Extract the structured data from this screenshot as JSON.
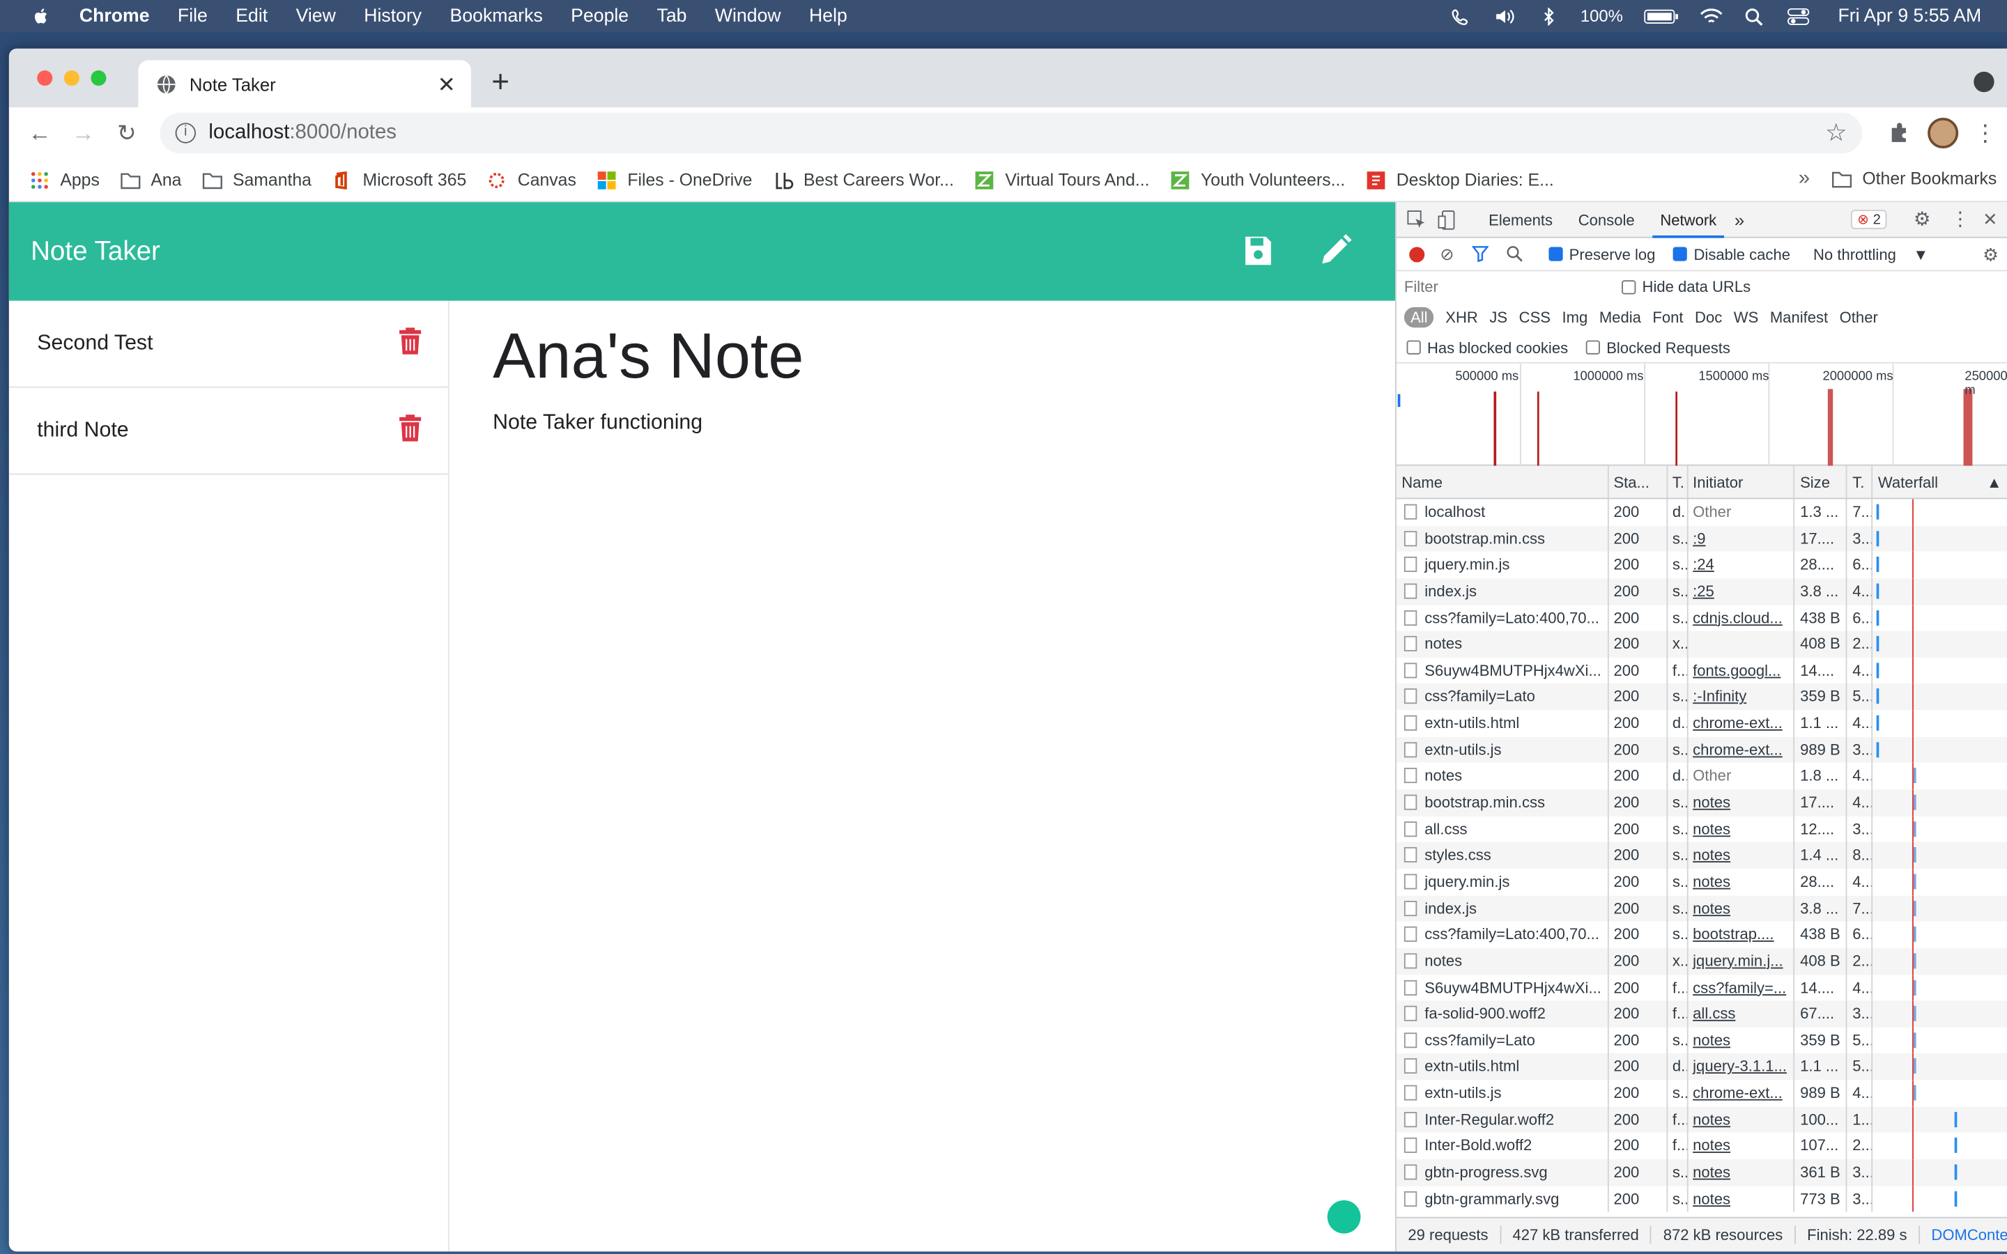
{
  "menubar": {
    "items": [
      "Chrome",
      "File",
      "Edit",
      "View",
      "History",
      "Bookmarks",
      "People",
      "Tab",
      "Window",
      "Help"
    ],
    "battery": "100%",
    "clock": "Fri Apr 9  5:55 AM"
  },
  "browser": {
    "tab_title": "Note Taker",
    "url_host": "localhost",
    "url_path": ":8000/notes",
    "bookmarks": [
      "Apps",
      "Ana",
      "Samantha",
      "Microsoft 365",
      "Canvas",
      "Files - OneDrive",
      "Best Careers Wor...",
      "Virtual Tours And...",
      "Youth Volunteers...",
      "Desktop Diaries: E..."
    ],
    "bookmarks_more": "»",
    "other_bookmarks": "Other Bookmarks"
  },
  "app": {
    "brand": "Note Taker",
    "notes": [
      "Second Test",
      "third Note"
    ],
    "active_title": "Ana's Note",
    "active_body": "Note Taker functioning"
  },
  "devtools": {
    "tabs": [
      "Elements",
      "Console",
      "Network"
    ],
    "more": "»",
    "error_count": "2",
    "preserve_log": "Preserve log",
    "disable_cache": "Disable cache",
    "throttling": "No throttling",
    "filter_placeholder": "Filter",
    "hide_data_urls": "Hide data URLs",
    "filter_types": [
      "All",
      "XHR",
      "JS",
      "CSS",
      "Img",
      "Media",
      "Font",
      "Doc",
      "WS",
      "Manifest",
      "Other"
    ],
    "has_blocked_cookies": "Has blocked cookies",
    "blocked_requests": "Blocked Requests",
    "timeline_ticks": [
      "500000 ms",
      "1000000 ms",
      "1500000 ms",
      "2000000 ms",
      "2500000 m"
    ],
    "columns": [
      "Name",
      "Sta...",
      "T.",
      "Initiator",
      "Size",
      "T.",
      "Waterfall"
    ],
    "rows": [
      [
        "localhost",
        "200",
        "d.",
        "Other",
        "1.3 ...",
        "7..."
      ],
      [
        "bootstrap.min.css",
        "200",
        "s..",
        ":9",
        "17....",
        "3..."
      ],
      [
        "jquery.min.js",
        "200",
        "s..",
        ":24",
        "28....",
        "6..."
      ],
      [
        "index.js",
        "200",
        "s..",
        ":25",
        "3.8 ...",
        "4..."
      ],
      [
        "css?family=Lato:400,70...",
        "200",
        "s..",
        "cdnjs.cloud...",
        "438 B",
        "6..."
      ],
      [
        "notes",
        "200",
        "x..",
        "",
        "408 B",
        "2..."
      ],
      [
        "S6uyw4BMUTPHjx4wXi...",
        "200",
        "f...",
        "fonts.googl...",
        "14....",
        "4..."
      ],
      [
        "css?family=Lato",
        "200",
        "s..",
        ":-Infinity",
        "359 B",
        "5..."
      ],
      [
        "extn-utils.html",
        "200",
        "d..",
        "chrome-ext...",
        "1.1 ...",
        "4..."
      ],
      [
        "extn-utils.js",
        "200",
        "s..",
        "chrome-ext...",
        "989 B",
        "3..."
      ],
      [
        "notes",
        "200",
        "d..",
        "Other",
        "1.8 ...",
        "4..."
      ],
      [
        "bootstrap.min.css",
        "200",
        "s..",
        "notes",
        "17....",
        "4..."
      ],
      [
        "all.css",
        "200",
        "s..",
        "notes",
        "12....",
        "3..."
      ],
      [
        "styles.css",
        "200",
        "s..",
        "notes",
        "1.4 ...",
        "8..."
      ],
      [
        "jquery.min.js",
        "200",
        "s..",
        "notes",
        "28....",
        "4..."
      ],
      [
        "index.js",
        "200",
        "s..",
        "notes",
        "3.8 ...",
        "7..."
      ],
      [
        "css?family=Lato:400,70...",
        "200",
        "s..",
        "bootstrap....",
        "438 B",
        "6..."
      ],
      [
        "notes",
        "200",
        "x..",
        "jquery.min.j...",
        "408 B",
        "2..."
      ],
      [
        "S6uyw4BMUTPHjx4wXi...",
        "200",
        "f...",
        "css?family=...",
        "14....",
        "4..."
      ],
      [
        "fa-solid-900.woff2",
        "200",
        "f...",
        "all.css",
        "67....",
        "3..."
      ],
      [
        "css?family=Lato",
        "200",
        "s..",
        "notes",
        "359 B",
        "5..."
      ],
      [
        "extn-utils.html",
        "200",
        "d..",
        "jquery-3.1.1...",
        "1.1 ...",
        "5..."
      ],
      [
        "extn-utils.js",
        "200",
        "s..",
        "chrome-ext...",
        "989 B",
        "4..."
      ],
      [
        "Inter-Regular.woff2",
        "200",
        "f...",
        "notes",
        "100...",
        "1..."
      ],
      [
        "Inter-Bold.woff2",
        "200",
        "f...",
        "notes",
        "107...",
        "2..."
      ],
      [
        "gbtn-progress.svg",
        "200",
        "s..",
        "notes",
        "361 B",
        "3..."
      ],
      [
        "gbtn-grammarly.svg",
        "200",
        "s..",
        "notes",
        "773 B",
        "3..."
      ]
    ],
    "status": [
      "29 requests",
      "427 kB transferred",
      "872 kB resources",
      "Finish: 22.89 s",
      "DOMConten"
    ]
  },
  "colors": {
    "accent": "#2bbb9a",
    "trash": "#dc3545",
    "record": "#d93025"
  }
}
